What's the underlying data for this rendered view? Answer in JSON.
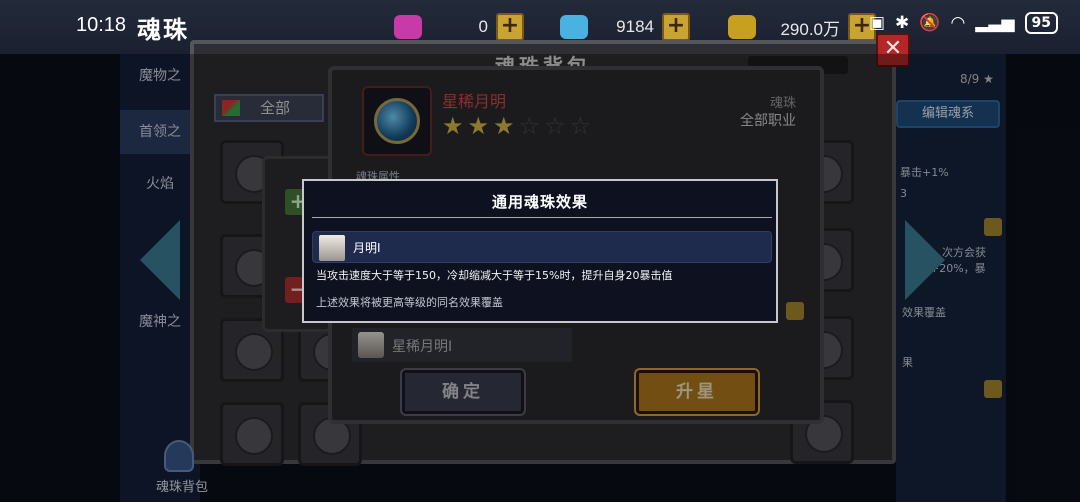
{
  "status_bar": {
    "time": "10:18",
    "battery": "95"
  },
  "header": {
    "title": "魂珠",
    "resources": [
      {
        "name": "pink-gem",
        "color": "#c83aa8",
        "value": "0"
      },
      {
        "name": "blue-diamond",
        "color": "#4ab2e0",
        "value": "9184"
      },
      {
        "name": "gold-chest",
        "color": "#c8a020",
        "value": "290.0万"
      }
    ]
  },
  "background": {
    "bag_title": "魂珠背包",
    "filter_label": "全部",
    "left_nav": [
      "魔物之",
      "首领之",
      "火焰",
      "魔神之"
    ],
    "right_panel": {
      "count": "8/9 ★",
      "edit_button": "编辑魂系",
      "texts": [
        "暴击+1%",
        "3",
        "次方会获",
        "+20%，暴",
        "效果覆盖",
        "果"
      ]
    },
    "bottom_label": "魂珠背包"
  },
  "detail": {
    "name": "星稀月明",
    "stars_filled": 3,
    "stars_total": 6,
    "type_label": "魂珠",
    "job_label": "全部职业",
    "attr_label": "魂珠属性",
    "list_item": "星稀月明Ⅰ",
    "confirm_button": "确定",
    "upstar_button": "升星"
  },
  "popup": {
    "title": "通用魂珠效果",
    "effect_name": "月明Ⅰ",
    "effect_desc": "当攻击速度大于等于150，冷却缩减大于等于15%时，提升自身20暴击值",
    "effect_note": "上述效果将被更高等级的同名效果覆盖"
  }
}
